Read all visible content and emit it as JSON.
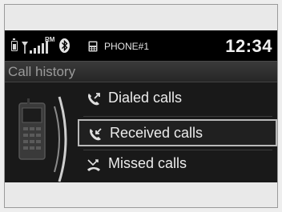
{
  "status_bar": {
    "roaming": "RM",
    "phone_name": "PHONE#1",
    "time": "12:34"
  },
  "screen": {
    "title": "Call history"
  },
  "menu": {
    "items": [
      {
        "label": "Dialed calls",
        "icon": "dialed-call-icon",
        "selected": false
      },
      {
        "label": "Received calls",
        "icon": "received-call-icon",
        "selected": true
      },
      {
        "label": "Missed calls",
        "icon": "missed-call-icon",
        "selected": false
      }
    ]
  }
}
